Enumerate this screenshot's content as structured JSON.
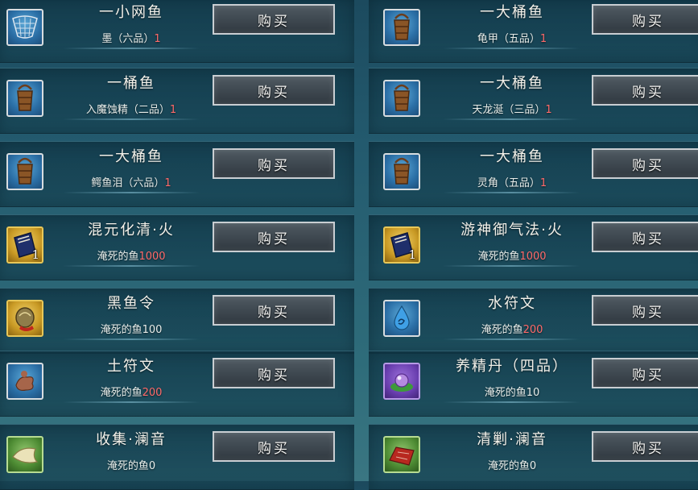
{
  "shop": {
    "buy_label": "购买",
    "left": [
      {
        "name": "一小网鱼",
        "price_prefix": "墨（六品）",
        "price_num": "1",
        "num_red": true,
        "icon": "fishing-net-icon",
        "icon_style": "blue",
        "qty": ""
      },
      {
        "name": "一桶鱼",
        "price_prefix": "入魔蚀精（二品）",
        "price_num": "1",
        "num_red": true,
        "icon": "fish-bucket-icon",
        "icon_style": "blue",
        "qty": ""
      },
      {
        "name": "一大桶鱼",
        "price_prefix": "鳄鱼泪（六品）",
        "price_num": "1",
        "num_red": true,
        "icon": "fish-bucket-icon",
        "icon_style": "blue",
        "qty": ""
      },
      {
        "name": "混元化清·火",
        "price_prefix": "淹死的鱼",
        "price_num": "1000",
        "num_red": true,
        "icon": "book-icon",
        "icon_style": "gold",
        "qty": "1"
      },
      {
        "name": "黑鱼令",
        "price_prefix": "淹死的鱼",
        "price_num": "100",
        "num_red": false,
        "icon": "token-icon",
        "icon_style": "gold",
        "qty": ""
      },
      {
        "name": "土符文",
        "price_prefix": "淹死的鱼",
        "price_num": "200",
        "num_red": true,
        "icon": "earth-rune-icon",
        "icon_style": "blue",
        "qty": ""
      },
      {
        "name": "收集·澜音",
        "price_prefix": "淹死的鱼",
        "price_num": "0",
        "num_red": false,
        "icon": "scroll-icon",
        "icon_style": "green",
        "qty": ""
      }
    ],
    "right": [
      {
        "name": "一大桶鱼",
        "price_prefix": "龟甲（五品）",
        "price_num": "1",
        "num_red": true,
        "icon": "fish-bucket-icon",
        "icon_style": "blue",
        "qty": ""
      },
      {
        "name": "一大桶鱼",
        "price_prefix": "天龙涎（三品）",
        "price_num": "1",
        "num_red": true,
        "icon": "fish-bucket-icon",
        "icon_style": "blue",
        "qty": ""
      },
      {
        "name": "一大桶鱼",
        "price_prefix": "灵角（五品）",
        "price_num": "1",
        "num_red": true,
        "icon": "fish-bucket-icon",
        "icon_style": "blue",
        "qty": ""
      },
      {
        "name": "游神御气法·火",
        "price_prefix": "淹死的鱼",
        "price_num": "1000",
        "num_red": true,
        "icon": "book-icon",
        "icon_style": "gold",
        "qty": "1"
      },
      {
        "name": "水符文",
        "price_prefix": "淹死的鱼",
        "price_num": "200",
        "num_red": true,
        "icon": "water-rune-icon",
        "icon_style": "blue",
        "qty": ""
      },
      {
        "name": "养精丹（四品）",
        "price_prefix": "淹死的鱼",
        "price_num": "10",
        "num_red": false,
        "icon": "pill-icon",
        "icon_style": "purple",
        "qty": ""
      },
      {
        "name": "清剿·澜音",
        "price_prefix": "淹死的鱼",
        "price_num": "0",
        "num_red": false,
        "icon": "scroll-icon",
        "icon_style": "green",
        "qty": ""
      }
    ]
  }
}
